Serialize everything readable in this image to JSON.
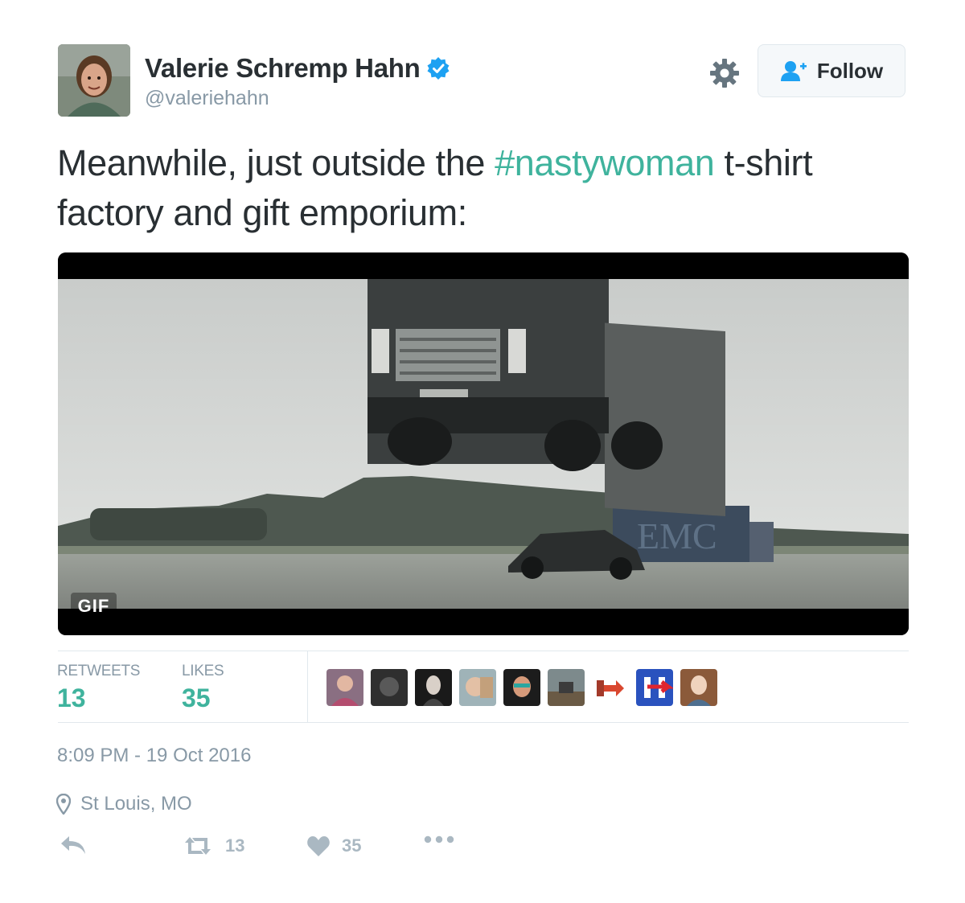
{
  "author": {
    "name": "Valerie Schremp Hahn",
    "handle": "@valeriehahn",
    "verified": true
  },
  "header": {
    "follow_label": "Follow"
  },
  "tweet": {
    "text_before": "Meanwhile, just outside the ",
    "hashtag": "#nastywoman",
    "text_after": " t-shirt factory and gift emporium:"
  },
  "media": {
    "badge": "GIF"
  },
  "stats": {
    "retweets_label": "RETWEETS",
    "retweets_value": "13",
    "likes_label": "LIKES",
    "likes_value": "35"
  },
  "likers": [
    "liker-1",
    "liker-2",
    "liker-3",
    "liker-4",
    "liker-5",
    "liker-6",
    "liker-7",
    "liker-8",
    "liker-9"
  ],
  "meta": {
    "timestamp": "8:09 PM - 19 Oct 2016",
    "location": "St Louis, MO"
  },
  "actions": {
    "retweet_count": "13",
    "like_count": "35"
  },
  "colors": {
    "accent": "#3fb39d",
    "muted": "#8899a6",
    "text": "#292f33",
    "verified": "#1da1f2"
  },
  "icons": [
    "gear-icon",
    "add-user-icon",
    "verified-icon",
    "location-pin-icon",
    "reply-icon",
    "retweet-icon",
    "heart-icon",
    "more-icon"
  ]
}
